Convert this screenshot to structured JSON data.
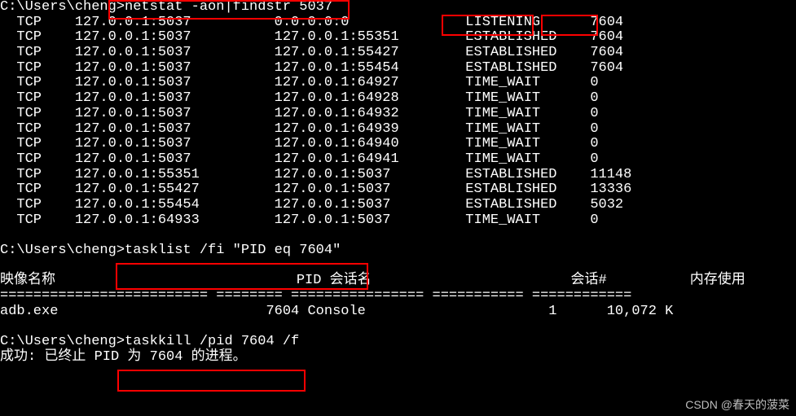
{
  "prompt": "C:\\Users\\cheng>",
  "cmd1": "netstat -aon|findstr 5037",
  "netstat": [
    {
      "proto": "TCP",
      "local": "127.0.0.1:5037",
      "foreign": "0.0.0.0:0",
      "state": "LISTENING",
      "pid": "7604"
    },
    {
      "proto": "TCP",
      "local": "127.0.0.1:5037",
      "foreign": "127.0.0.1:55351",
      "state": "ESTABLISHED",
      "pid": "7604"
    },
    {
      "proto": "TCP",
      "local": "127.0.0.1:5037",
      "foreign": "127.0.0.1:55427",
      "state": "ESTABLISHED",
      "pid": "7604"
    },
    {
      "proto": "TCP",
      "local": "127.0.0.1:5037",
      "foreign": "127.0.0.1:55454",
      "state": "ESTABLISHED",
      "pid": "7604"
    },
    {
      "proto": "TCP",
      "local": "127.0.0.1:5037",
      "foreign": "127.0.0.1:64927",
      "state": "TIME_WAIT",
      "pid": "0"
    },
    {
      "proto": "TCP",
      "local": "127.0.0.1:5037",
      "foreign": "127.0.0.1:64928",
      "state": "TIME_WAIT",
      "pid": "0"
    },
    {
      "proto": "TCP",
      "local": "127.0.0.1:5037",
      "foreign": "127.0.0.1:64932",
      "state": "TIME_WAIT",
      "pid": "0"
    },
    {
      "proto": "TCP",
      "local": "127.0.0.1:5037",
      "foreign": "127.0.0.1:64939",
      "state": "TIME_WAIT",
      "pid": "0"
    },
    {
      "proto": "TCP",
      "local": "127.0.0.1:5037",
      "foreign": "127.0.0.1:64940",
      "state": "TIME_WAIT",
      "pid": "0"
    },
    {
      "proto": "TCP",
      "local": "127.0.0.1:5037",
      "foreign": "127.0.0.1:64941",
      "state": "TIME_WAIT",
      "pid": "0"
    },
    {
      "proto": "TCP",
      "local": "127.0.0.1:55351",
      "foreign": "127.0.0.1:5037",
      "state": "ESTABLISHED",
      "pid": "11148"
    },
    {
      "proto": "TCP",
      "local": "127.0.0.1:55427",
      "foreign": "127.0.0.1:5037",
      "state": "ESTABLISHED",
      "pid": "13336"
    },
    {
      "proto": "TCP",
      "local": "127.0.0.1:55454",
      "foreign": "127.0.0.1:5037",
      "state": "ESTABLISHED",
      "pid": "5032"
    },
    {
      "proto": "TCP",
      "local": "127.0.0.1:64933",
      "foreign": "127.0.0.1:5037",
      "state": "TIME_WAIT",
      "pid": "0"
    }
  ],
  "cmd2": "tasklist /fi \"PID eq 7604\"",
  "th": {
    "image": "映像名称",
    "pid": "PID",
    "session": "会话名",
    "sessnum": "会话#",
    "mem": "内存使用"
  },
  "sep": {
    "c1": "=========================",
    "c2": "========",
    "c3": "================",
    "c4": "===========",
    "c5": "============"
  },
  "task": {
    "image": "adb.exe",
    "pid": "7604",
    "session": "Console",
    "sessnum": "1",
    "mem": "10,072 K"
  },
  "cmd3": "taskkill /pid 7604 /f",
  "result": "成功: 已终止 PID 为 7604 的进程。",
  "watermark": "CSDN @春天的菠菜",
  "highlight": {
    "state": "LISTENING",
    "pid": "7604"
  }
}
